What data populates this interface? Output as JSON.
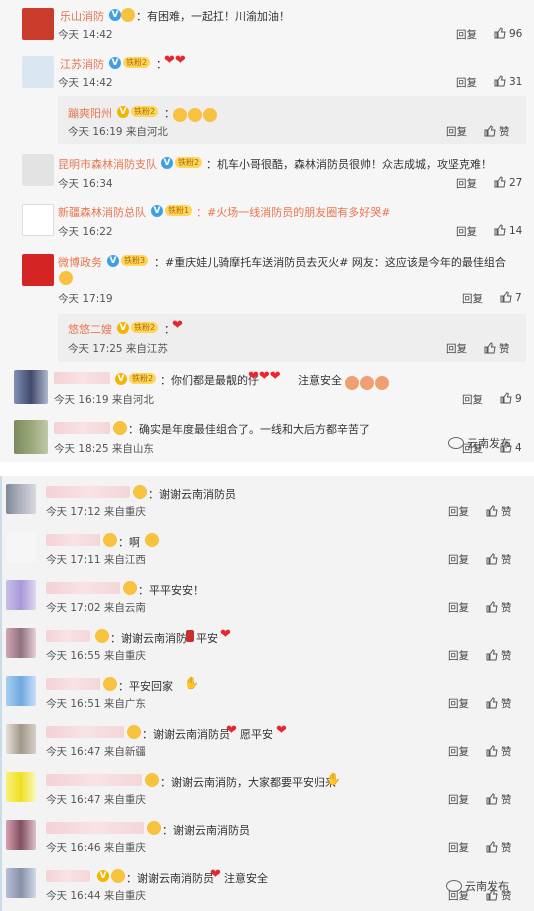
{
  "reply_label": "回复",
  "like_label": "赞",
  "watermark": "云南发布",
  "panel1": {
    "comments": [
      {
        "name": "乐山消防",
        "text": "：有困难，一起扛！川渝加油！",
        "time": "今天 14:42",
        "likes": "96"
      },
      {
        "name": "江苏消防",
        "text": "：",
        "time": "今天 14:42",
        "likes": "31"
      },
      {
        "name": "蹦爽阳州",
        "text": "：",
        "time": "今天 16:19 来自河北",
        "likes": "赞"
      },
      {
        "name": "昆明市森林消防支队",
        "text": "：机车小哥很酷，森林消防员很帅！众志成城，攻坚克难！",
        "time": "今天 16:34",
        "likes": "27"
      },
      {
        "name": "新疆森林消防总队",
        "text": "：#火场一线消防员的朋友圈有多好哭#",
        "time": "今天 16:22",
        "likes": "14"
      },
      {
        "name": "微博政务",
        "text": "：#重庆娃儿骑摩托车送消防员去灭火# 网友：这应该是今年的最佳组合",
        "time": "今天 17:19",
        "likes": "7"
      },
      {
        "name": "悠悠二嫂",
        "text": "：",
        "time": "今天 17:25 来自江苏",
        "likes": "赞"
      },
      {
        "name": "",
        "text": "：你们都是最靓的仔",
        "text2": "注意安全",
        "time": "今天 16:19 来自河北",
        "likes": "9"
      },
      {
        "name": "",
        "text": "：确实是年度最佳组合了。一线和大后方都辛苦了",
        "time": "今天 18:25 来自山东",
        "likes": "4"
      }
    ],
    "badges": {
      "b1": "铁粉2",
      "b2": "铁粉2",
      "b3": "铁粉2",
      "b4": "铁粉1",
      "b5": "铁粉3",
      "b6": "铁粉2",
      "b7": "铁粉2"
    }
  },
  "panel2": {
    "comments": [
      {
        "text": "：谢谢云南消防员",
        "time": "今天 17:12 来自重庆",
        "likes": "赞"
      },
      {
        "text": "：啊",
        "time": "今天 17:11 来自江西",
        "likes": "赞"
      },
      {
        "text": "：平平安安！",
        "time": "今天 17:02 来自云南",
        "likes": "赞"
      },
      {
        "text": "：谢谢云南消防",
        "text2": "平安",
        "time": "今天 16:55 来自重庆",
        "likes": "赞"
      },
      {
        "text": "：平安回家",
        "time": "今天 16:51 来自广东",
        "likes": "赞"
      },
      {
        "text": "：谢谢云南消防员",
        "text2": "愿平安",
        "time": "今天 16:47 来自新疆",
        "likes": "赞"
      },
      {
        "text": "：谢谢云南消防，大家都要平安归来",
        "time": "今天 16:47 来自重庆",
        "likes": "赞"
      },
      {
        "text": "：谢谢云南消防员",
        "time": "今天 16:46 来自重庆",
        "likes": "赞"
      },
      {
        "text": "：谢谢云南消防员",
        "text2": "注意安全",
        "time": "今天 16:44 来自重庆",
        "likes": "赞"
      }
    ]
  }
}
